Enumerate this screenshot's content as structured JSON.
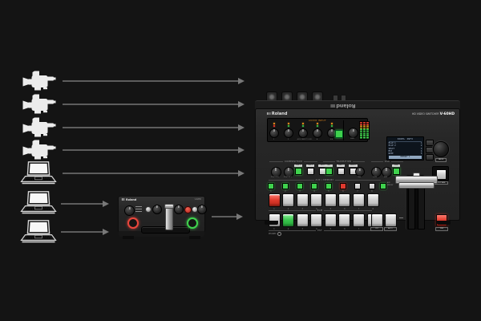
{
  "background": "#141414",
  "colors": {
    "arrow": "#5d5d5d",
    "accent_green": "#3fd24d",
    "accent_red": "#e0392e",
    "amber": "#e8891a",
    "lcd_text": "#b9cbe4"
  },
  "sources": {
    "cameras": [
      "camera-1",
      "camera-2",
      "camera-3",
      "camera-4"
    ],
    "laptops": [
      "laptop-1",
      "laptop-2",
      "laptop-3"
    ]
  },
  "mixer": {
    "brand": "Roland",
    "model": "V-02HD"
  },
  "switcher": {
    "brand": "Roland",
    "product_line": "HD VIDEO SWITCHER",
    "model": "V-60HD",
    "audio": {
      "header": "AUDIO INPUT",
      "knob_labels": [
        "1",
        "2",
        "3",
        "4",
        "5/6"
      ],
      "level_label": "AUDIO INPUT LEVEL",
      "main_label": "MAIN"
    },
    "lcd": {
      "title": "PANEL INFO",
      "rows": [
        {
          "l": "PinP 1",
          "r": "1"
        },
        {
          "l": "PinP 2",
          "r": "2"
        },
        {
          "l": "SPLIT",
          "r": "3"
        },
        {
          "l": "MIX",
          "r": "4"
        },
        {
          "l": "WIPE",
          "r": "5"
        }
      ],
      "footer": "MEMORY 1"
    },
    "value_dial_label": "VALUE",
    "composition": {
      "label": "COMPOSITION",
      "knob_labels": [
        "POSITION H",
        "POSITION V"
      ],
      "buttons": [
        {
          "label": "PinP 1",
          "color": "green"
        },
        {
          "label": "PinP 2",
          "color": "white"
        },
        {
          "label": "SPLIT",
          "color": "white"
        }
      ]
    },
    "transition": {
      "label": "TRANSITION",
      "buttons": [
        {
          "label": "MIX",
          "color": "green"
        },
        {
          "label": "WIPE 1",
          "color": "white"
        },
        {
          "label": "WIPE 2",
          "color": "white"
        }
      ],
      "knob_label": "TIME"
    },
    "dsk": {
      "label": "DSK",
      "knob_labels": [
        "LEVEL",
        "GAIN"
      ],
      "button_label": "PVW"
    },
    "output_fade_label": "OUTPUT FADE",
    "aux_memory": {
      "header": "AUX / MEMORY",
      "keys": [
        {
          "n": "1",
          "c": "green"
        },
        {
          "n": "2",
          "c": "green"
        },
        {
          "n": "3",
          "c": "green"
        },
        {
          "n": "4",
          "c": "green"
        },
        {
          "n": "5",
          "c": "green"
        },
        {
          "n": "6",
          "c": "red"
        },
        {
          "n": "7",
          "c": "gray"
        },
        {
          "n": "8",
          "c": "gray"
        }
      ],
      "mode_labels": [
        "AUX",
        "MEMORY"
      ]
    },
    "pgm": {
      "label": "PGM",
      "keys": [
        {
          "n": "1",
          "c": "red"
        },
        {
          "n": "2",
          "c": "white"
        },
        {
          "n": "3",
          "c": "white"
        },
        {
          "n": "4",
          "c": "white"
        },
        {
          "n": "5",
          "c": "white"
        },
        {
          "n": "6",
          "c": "white"
        },
        {
          "n": "7",
          "c": "white"
        },
        {
          "n": "8",
          "c": "white"
        }
      ]
    },
    "pst": {
      "label": "PST",
      "keys": [
        {
          "n": "1",
          "c": "white"
        },
        {
          "n": "2",
          "c": "green"
        },
        {
          "n": "3",
          "c": "white"
        },
        {
          "n": "4",
          "c": "white"
        },
        {
          "n": "5",
          "c": "white"
        },
        {
          "n": "6",
          "c": "white"
        },
        {
          "n": "7",
          "c": "white"
        },
        {
          "n": "8",
          "c": "white"
        }
      ]
    },
    "cut_label": "CUT",
    "auto_label": "AUTO",
    "dsk_button_label": "DSK",
    "phones_label": "PHONES"
  }
}
